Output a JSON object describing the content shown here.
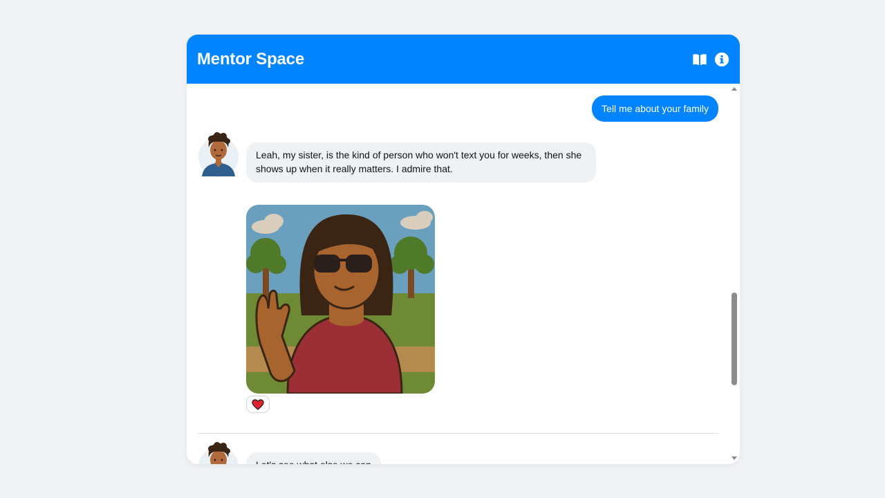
{
  "header": {
    "title": "Mentor Space",
    "icons": [
      "book-icon",
      "info-icon"
    ],
    "color": "#0084ff"
  },
  "messages": {
    "user_1": "Tell me about your family",
    "bot_1": "Leah, my sister, is the kind of person who won't text you for weeks, then she shows up when it really matters. I admire that.",
    "bot_2": "Let's see what else we can"
  },
  "reaction": {
    "icon": "heart-icon",
    "color": "#e0242f"
  },
  "colors": {
    "user_bubble": "#0084ff",
    "bot_bubble": "#eef2f5",
    "page_background": "#f0f2f5"
  }
}
